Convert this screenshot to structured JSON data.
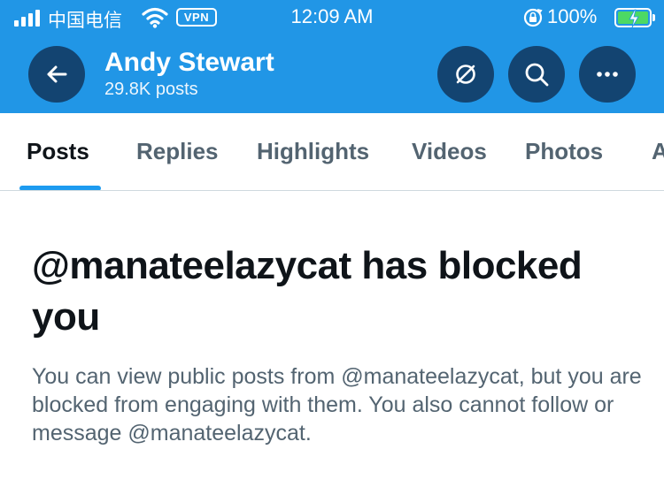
{
  "status_bar": {
    "carrier": "中国电信",
    "vpn_label": "VPN",
    "time": "12:09 AM",
    "battery_percent": "100%",
    "signal_icon": "signal-bars-icon",
    "wifi_icon": "wifi-icon",
    "rotation_lock_icon": "rotation-lock-icon",
    "battery_icon": "battery-charging-icon"
  },
  "header": {
    "name": "Andy Stewart",
    "posts_count": "29.8K posts",
    "background_color": "#2196e6",
    "back_icon": "arrow-left-icon",
    "actions": [
      {
        "icon": "grok-icon"
      },
      {
        "icon": "search-icon"
      },
      {
        "icon": "more-icon"
      }
    ]
  },
  "tabs": [
    {
      "label": "Posts",
      "active": true
    },
    {
      "label": "Replies",
      "active": false
    },
    {
      "label": "Highlights",
      "active": false
    },
    {
      "label": "Videos",
      "active": false
    },
    {
      "label": "Photos",
      "active": false
    },
    {
      "label": "A",
      "active": false
    }
  ],
  "blocked": {
    "title": "@manateelazycat has blocked you",
    "description": "You can view public posts from @manateelazycat, but you are blocked from engaging with them. You also cannot follow or message @manateelazycat."
  },
  "colors": {
    "accent": "#1d9bf0",
    "text_primary": "#0f1419",
    "text_secondary": "#536471"
  }
}
